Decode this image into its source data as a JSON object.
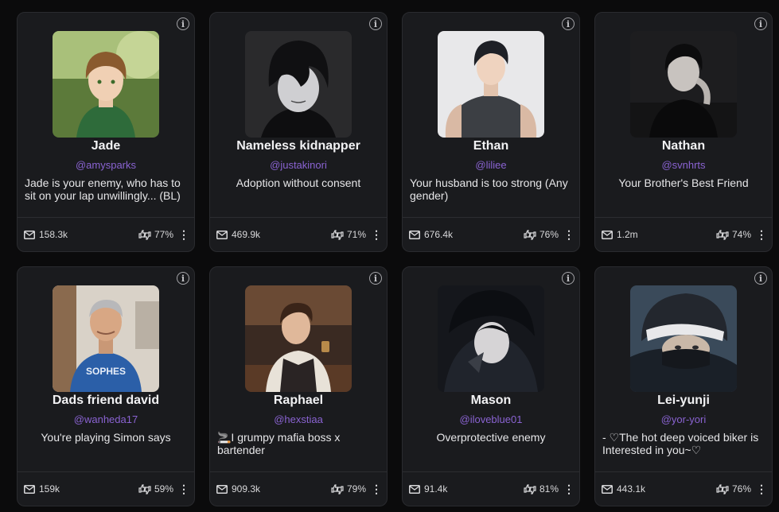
{
  "cards": [
    {
      "name": "Jade",
      "handle": "@amysparks",
      "description": "Jade is your enemy, who has to sit on your lap unwillingly... (BL)",
      "messages": "158.3k",
      "rating": "77%",
      "desc_align": "left",
      "avatar": "green-sweater-anime-boy"
    },
    {
      "name": "Nameless kidnapper",
      "handle": "@justakinori",
      "description": "Adoption without consent",
      "messages": "469.9k",
      "rating": "71%",
      "desc_align": "center",
      "avatar": "dark-hair-monochrome-man"
    },
    {
      "name": "Ethan",
      "handle": "@liliee",
      "description": "Your husband is too strong (Any gender)",
      "messages": "676.4k",
      "rating": "76%",
      "desc_align": "left",
      "avatar": "muscular-man-dark-shirt"
    },
    {
      "name": "Nathan",
      "handle": "@svnhrts",
      "description": "Your Brother's Best Friend",
      "messages": "1.2m",
      "rating": "74%",
      "desc_align": "center",
      "avatar": "sitting-man-dark-room"
    },
    {
      "name": "Dads friend david",
      "handle": "@wanheda17",
      "description": "You're playing Simon says",
      "messages": "159k",
      "rating": "59%",
      "desc_align": "center",
      "avatar": "gray-haired-man-blue-shirt"
    },
    {
      "name": "Raphael",
      "handle": "@hexstiaa",
      "description": "🚬I grumpy mafia boss x bartender",
      "messages": "909.3k",
      "rating": "79%",
      "desc_align": "left",
      "avatar": "bartender-vest-man"
    },
    {
      "name": "Mason",
      "handle": "@iloveblue01",
      "description": "Overprotective enemy",
      "messages": "91.4k",
      "rating": "81%",
      "desc_align": "center",
      "avatar": "dark-hooded-anime-boy"
    },
    {
      "name": "Lei-yunji",
      "handle": "@yor-yori",
      "description": "- ♡The hot deep voiced biker is Interested in you~♡",
      "messages": "443.1k",
      "rating": "76%",
      "desc_align": "left",
      "avatar": "helmet-biker-masked"
    }
  ],
  "colors": {
    "background": "#0b0b0c",
    "card": "#1a1b1e",
    "handle": "#8a63d2"
  },
  "icons": {
    "info": "info-icon",
    "messages": "message-envelope-icon",
    "rating": "thumbs-up-down-icon",
    "more": "more-vertical-icon"
  }
}
